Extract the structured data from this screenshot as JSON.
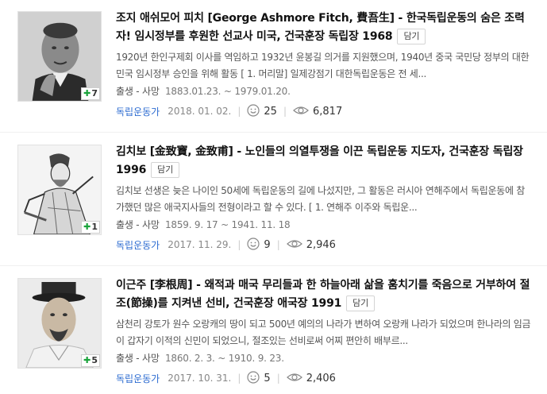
{
  "items": [
    {
      "title": "조지 애쉬모어 피치 [George Ashmore Fitch, 費吾生] - 한국독립운동의 숨은 조력자! 임시정부를 후원한 선교사 미국, 건국훈장 독립장 1968",
      "save_label": "담기",
      "count": "7",
      "description": "1920년 한인구제회 이사를 역임하고 1932년 윤봉길 의거를 지원했으며, 1940년 중국 국민당 정부의 대한민국 임시정부 승인을 위해 활동 [ 1. 머리말] 일제강점기 대한독립운동은 전 세...",
      "life_label": "출생 - 사망",
      "life_dates": "1883.01.23. ~ 1979.01.20.",
      "category": "독립운동가",
      "date": "2018. 01. 02.",
      "likes": "25",
      "views": "6,817"
    },
    {
      "title": "김치보 [金致寶, 金致甫] - 노인들의 의열투쟁을 이끈 독립운동 지도자, 건국훈장 독립장 1996",
      "save_label": "담기",
      "count": "1",
      "description": "김치보 선생은 늦은 나이인 50세에 독립운동의 길에 나섰지만, 그 활동은 러시아 연해주에서 독립운동에 참가했던 많은 애국지사들의 전형이라고 할 수 있다. [ 1. 연해주 이주와 독립운...",
      "life_label": "출생 - 사망",
      "life_dates": "1859. 9. 17 ~ 1941. 11. 18",
      "category": "독립운동가",
      "date": "2017. 11. 29.",
      "likes": "9",
      "views": "2,946"
    },
    {
      "title": "이근주 [李根周] - 왜적과 매국 무리들과 한 하늘아래 삶을 훔치기를 죽음으로 거부하여 절조(節操)를 지켜낸 선비, 건국훈장 애국장 1991",
      "save_label": "담기",
      "count": "5",
      "description": "삼천리 강토가 원수 오랑캐의 땅이 되고 500년 예의의 나라가 변하여 오랑캐 나라가 되었으며 한나라의 임금이 갑자기 이적의 신민이 되었으니, 절조있는 선비로써 어찌 편안히 배부르...",
      "life_label": "출생 - 사망",
      "life_dates": "1860. 2. 3. ~ 1910. 9. 23.",
      "category": "독립운동가",
      "date": "2017. 10. 31.",
      "likes": "5",
      "views": "2,406"
    }
  ]
}
